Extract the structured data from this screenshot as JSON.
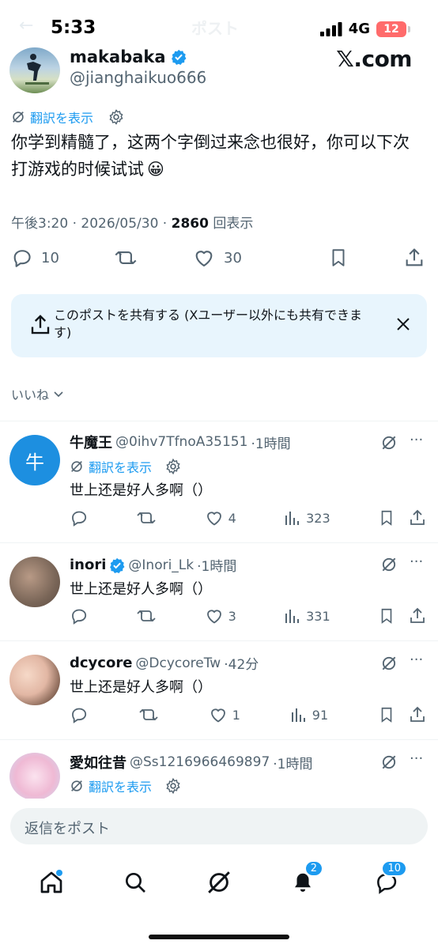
{
  "status": {
    "time": "5:33",
    "network": "4G",
    "battery": "12"
  },
  "header": {
    "back": "←",
    "title": "ポスト"
  },
  "post": {
    "author_name": "makabaka",
    "handle": "@jianghaikuo666",
    "site": "𝕏.com",
    "translate_label": "翻訳を表示",
    "text": "你学到精髓了，这两个字倒过来念也很好，你可以下次打游戏的时候试试",
    "emoji": "😀",
    "time": "午後3:20",
    "date": "2026/05/30",
    "views": "2860",
    "views_label": "回表示",
    "replies": "10",
    "likes": "30"
  },
  "share_card": {
    "text": "このポストを共有する (Xユーザー以外にも共有できます)"
  },
  "sort": {
    "label": "いいね"
  },
  "replies": [
    {
      "name": "牛魔王",
      "avatar_text": "牛",
      "handle": "@0ihv7TfnoA35151",
      "time": "·1時間",
      "translate": "翻訳を表示",
      "text": "世上还是好人多啊（）",
      "likes": "4",
      "views": "323"
    },
    {
      "name": "inori",
      "handle": "@Inori_Lk",
      "time": "·1時間",
      "text": "世上还是好人多啊（）",
      "likes": "3",
      "views": "331"
    },
    {
      "name": "dcycore",
      "handle": "@DcycoreTw",
      "time": "·42分",
      "text": "世上还是好人多啊（）",
      "likes": "1",
      "views": "91"
    },
    {
      "name": "愛如往昔",
      "handle": "@Ss1216966469897",
      "time": "·1時間",
      "translate": "翻訳を表示"
    }
  ],
  "reply_input": {
    "placeholder": "返信をポスト"
  },
  "tabbar": {
    "notifications_badge": "2",
    "messages_badge": "10"
  },
  "colors": {
    "accent": "#1d9bf0",
    "text": "#0f1419",
    "muted": "#536471",
    "share_bg": "#e8f5fd"
  }
}
